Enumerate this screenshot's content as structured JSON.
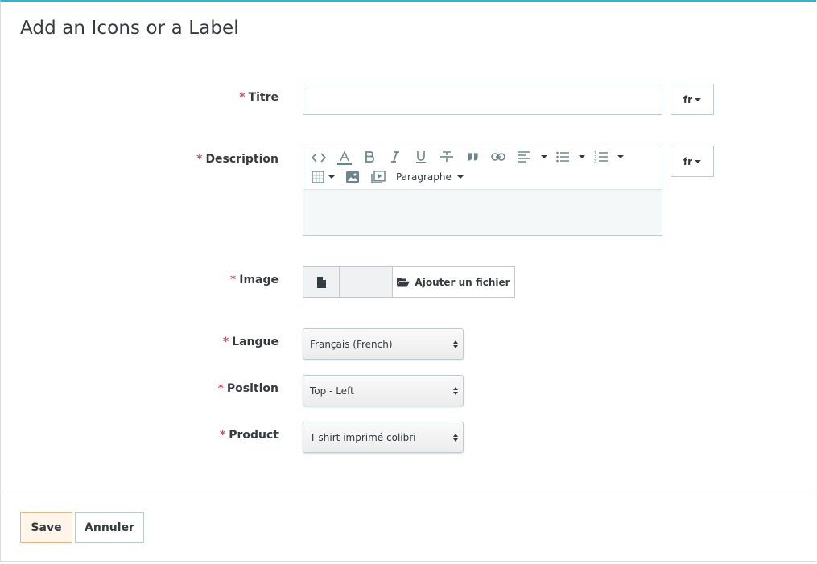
{
  "panel": {
    "title": "Add an Icons or a Label"
  },
  "form": {
    "required_mark": "*",
    "titre": {
      "label": "Titre",
      "value": "",
      "lang": "fr"
    },
    "description": {
      "label": "Description",
      "lang": "fr",
      "toolbar": {
        "icons": [
          "code-icon",
          "text-color-icon",
          "bold-icon",
          "italic-icon",
          "underline-icon",
          "strikethrough-icon",
          "quote-icon",
          "link-icon",
          "align-icon",
          "bullet-list-icon",
          "numbered-list-icon",
          "table-icon",
          "image-icon",
          "media-icon"
        ],
        "paragraph_label": "Paragraphe"
      },
      "value": ""
    },
    "image": {
      "label": "Image",
      "button_label": "Ajouter un fichier"
    },
    "langue": {
      "label": "Langue",
      "selected": "Français (French)"
    },
    "position": {
      "label": "Position",
      "selected": "Top - Left"
    },
    "product": {
      "label": "Product",
      "selected": "T-shirt imprimé colibri"
    }
  },
  "footer": {
    "save_label": "Save",
    "cancel_label": "Annuler"
  },
  "colors": {
    "accent": "#25b9d7",
    "required": "#c05c67",
    "save_bg": "#fff5e8",
    "save_border": "#f2b07f"
  }
}
